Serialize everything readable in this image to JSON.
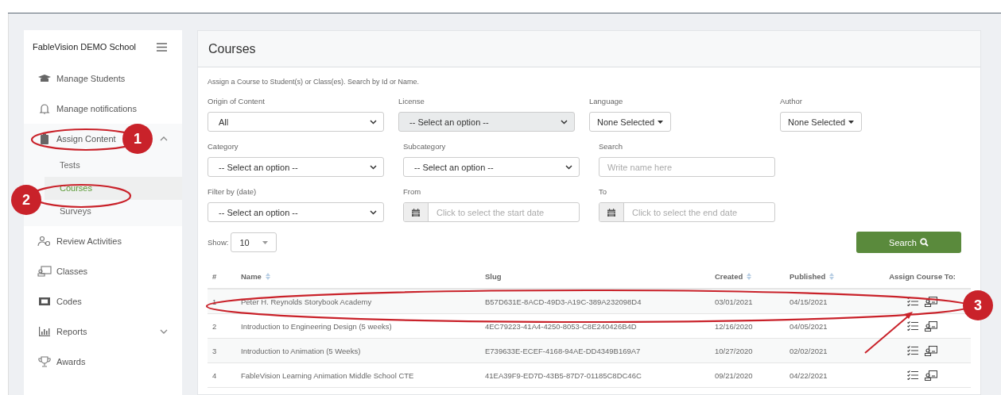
{
  "sidebar": {
    "school": "FableVision DEMO School",
    "items": [
      {
        "label": "Manage Students",
        "kind": "cap"
      },
      {
        "label": "Manage notifications",
        "kind": "bell"
      },
      {
        "label": "Assign Content",
        "kind": "clipboard",
        "expanded": true,
        "children": [
          {
            "label": "Tests",
            "selected": false
          },
          {
            "label": "Courses",
            "selected": true
          },
          {
            "label": "Surveys",
            "selected": false
          }
        ]
      },
      {
        "label": "Review Activities",
        "kind": "people"
      },
      {
        "label": "Classes",
        "kind": "board"
      },
      {
        "label": "Codes",
        "kind": "ticket"
      },
      {
        "label": "Reports",
        "kind": "chart",
        "expanded": false
      },
      {
        "label": "Awards",
        "kind": "trophy"
      }
    ]
  },
  "page": {
    "title": "Courses",
    "description": "Assign a Course to Student(s) or Class(es). Search by Id or Name.",
    "filter_rows": [
      [
        {
          "label": "Origin of Content",
          "kind": "select",
          "value": "All",
          "disabled": false
        },
        {
          "label": "License",
          "kind": "select",
          "value": "-- Select an option --",
          "disabled": true
        },
        {
          "label": "Language",
          "kind": "multiselect",
          "value": "None Selected",
          "disabled": false
        },
        {
          "label": "Author",
          "kind": "multiselect",
          "value": "None Selected",
          "disabled": false
        }
      ],
      [
        {
          "label": "Category",
          "kind": "select",
          "value": "-- Select an option --",
          "disabled": false
        },
        {
          "label": "Subcategory",
          "kind": "select",
          "value": "-- Select an option --",
          "disabled": false
        },
        {
          "label": "Search",
          "kind": "text",
          "placeholder": "Write name here",
          "disabled": false
        }
      ],
      [
        {
          "label": "Filter by (date)",
          "kind": "select",
          "value": "-- Select an option --",
          "disabled": false
        },
        {
          "label": "From",
          "kind": "date",
          "placeholder": "Click to select the start date",
          "disabled": false
        },
        {
          "label": "To",
          "kind": "date",
          "placeholder": "Click to select the end date",
          "disabled": false
        }
      ]
    ],
    "show_label": "Show:",
    "show_value": "10",
    "search_button": "Search"
  },
  "table": {
    "columns": [
      {
        "label": "#",
        "sortable": false
      },
      {
        "label": "Name",
        "sortable": true
      },
      {
        "label": "Slug",
        "sortable": false
      },
      {
        "label": "Created",
        "sortable": true
      },
      {
        "label": "Published",
        "sortable": true
      },
      {
        "label": "Assign Course To:",
        "sortable": false
      }
    ],
    "rows": [
      {
        "cells": [
          "1",
          "Peter H. Reynolds Storybook Academy",
          "B57D631E-8ACD-49D3-A19C-389A232098D4",
          "03/01/2021",
          "04/15/2021"
        ]
      },
      {
        "cells": [
          "2",
          "Introduction to Engineering Design (5 weeks)",
          "4EC79223-41A4-4250-8053-C8E240426B4D",
          "12/16/2020",
          "04/05/2021"
        ]
      },
      {
        "cells": [
          "3",
          "Introduction to Animation (5 Weeks)",
          "E739633E-ECEF-4168-94AE-DD4349B169A7",
          "10/27/2020",
          "02/02/2021"
        ]
      },
      {
        "cells": [
          "4",
          "FableVision Learning Animation Middle School CTE",
          "41EA39F9-ED7D-43B5-87D7-01185C8DC46C",
          "09/21/2020",
          "04/22/2021"
        ]
      }
    ]
  },
  "annotations": [
    {
      "label": "1"
    },
    {
      "label": "2"
    },
    {
      "label": "3"
    }
  ]
}
